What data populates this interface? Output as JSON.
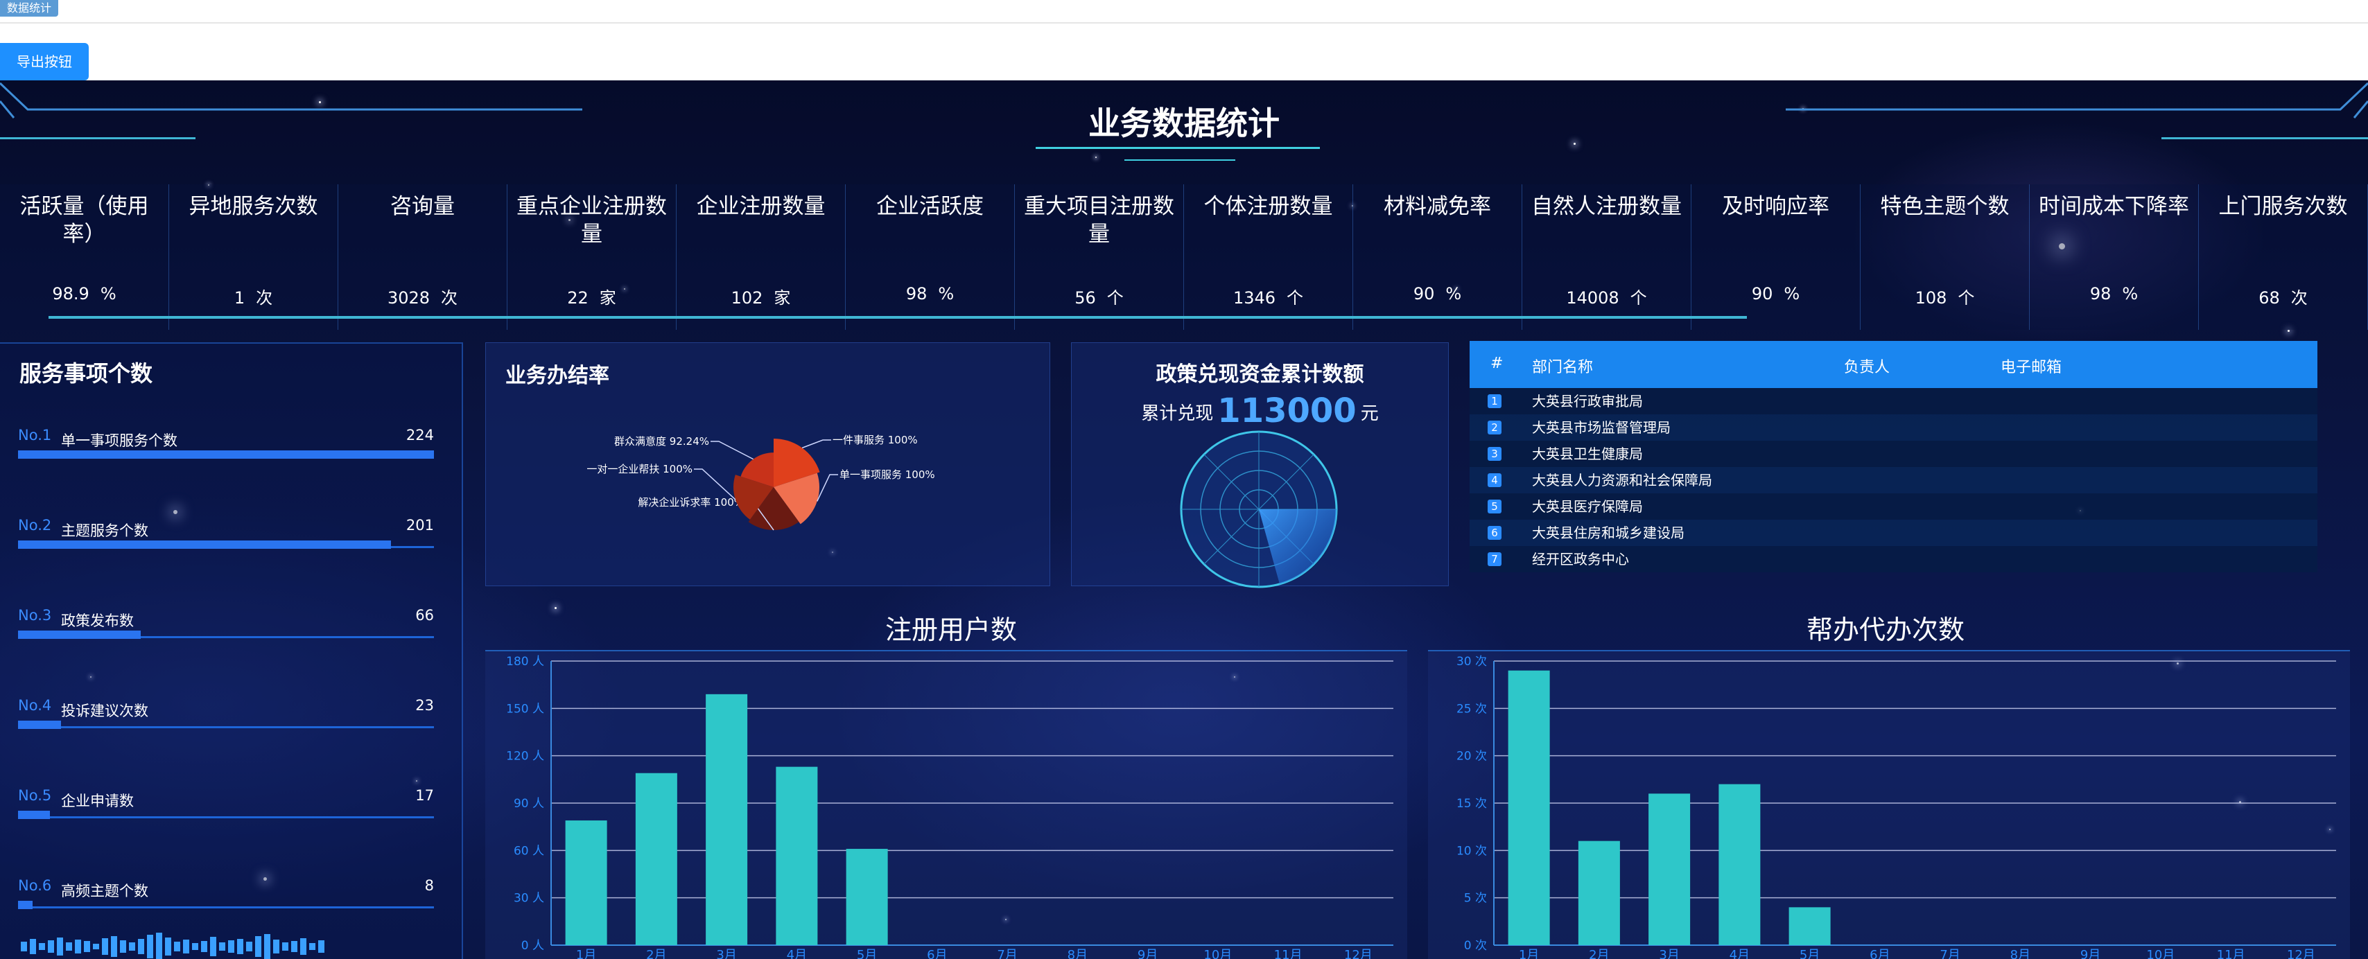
{
  "top": {
    "tab_label": "数据统计",
    "export_label": "导出按钮"
  },
  "title": "业务数据统计",
  "stats": [
    {
      "label": "活跃量（使用率）",
      "value": "98.9",
      "unit": "%"
    },
    {
      "label": "异地服务次数",
      "value": "1",
      "unit": "次"
    },
    {
      "label": "咨询量",
      "value": "3028",
      "unit": "次"
    },
    {
      "label": "重点企业注册数量",
      "value": "22",
      "unit": "家"
    },
    {
      "label": "企业注册数量",
      "value": "102",
      "unit": "家"
    },
    {
      "label": "企业活跃度",
      "value": "98",
      "unit": "%"
    },
    {
      "label": "重大项目注册数量",
      "value": "56",
      "unit": "个"
    },
    {
      "label": "个体注册数量",
      "value": "1346",
      "unit": "个"
    },
    {
      "label": "材料减免率",
      "value": "90",
      "unit": "%"
    },
    {
      "label": "自然人注册数量",
      "value": "14008",
      "unit": "个"
    },
    {
      "label": "及时响应率",
      "value": "90",
      "unit": "%"
    },
    {
      "label": "特色主题个数",
      "value": "108",
      "unit": "个"
    },
    {
      "label": "时间成本下降率",
      "value": "98",
      "unit": "%"
    },
    {
      "label": "上门服务次数",
      "value": "68",
      "unit": "次"
    }
  ],
  "services": {
    "title": "服务事项个数",
    "max": 224,
    "items": [
      {
        "no": "No.1",
        "name": "单一事项服务个数",
        "count": 224
      },
      {
        "no": "No.2",
        "name": "主题服务个数",
        "count": 201
      },
      {
        "no": "No.3",
        "name": "政策发布数",
        "count": 66
      },
      {
        "no": "No.4",
        "name": "投诉建议次数",
        "count": 23
      },
      {
        "no": "No.5",
        "name": "企业申请数",
        "count": 17
      },
      {
        "no": "No.6",
        "name": "高频主题个数",
        "count": 8
      }
    ]
  },
  "rate": {
    "title": "业务办结率",
    "slices": [
      {
        "label": "一件事服务 100%",
        "value": 100,
        "color": "#e0401c"
      },
      {
        "label": "单一事项服务 100%",
        "value": 100,
        "color": "#f07050"
      },
      {
        "label": "解决企业诉求率 100%",
        "value": 100,
        "color": "#6a1a12"
      },
      {
        "label": "一对一企业帮扶 100%",
        "value": 100,
        "color": "#a02a14"
      },
      {
        "label": "群众满意度 92.24%",
        "value": 92.24,
        "color": "#c8321a"
      }
    ]
  },
  "fund": {
    "title": "政策兑现资金累计数额",
    "prefix": "累计兑现",
    "amount": "113000",
    "unit": "元"
  },
  "departments": {
    "headers": {
      "idx": "#",
      "name": "部门名称",
      "owner": "负责人",
      "email": "电子邮箱"
    },
    "rows": [
      {
        "idx": "1",
        "name": "大英县行政审批局"
      },
      {
        "idx": "2",
        "name": "大英县市场监督管理局"
      },
      {
        "idx": "3",
        "name": "大英县卫生健康局"
      },
      {
        "idx": "4",
        "name": "大英县人力资源和社会保障局"
      },
      {
        "idx": "5",
        "name": "大英县医疗保障局"
      },
      {
        "idx": "6",
        "name": "大英县住房和城乡建设局"
      },
      {
        "idx": "7",
        "name": "经开区政务中心"
      }
    ]
  },
  "chart_data": [
    {
      "type": "bar",
      "title": "注册用户数",
      "categories": [
        "1月",
        "2月",
        "3月",
        "4月",
        "5月",
        "6月",
        "7月",
        "8月",
        "9月",
        "10月",
        "11月",
        "12月"
      ],
      "values": [
        79,
        109,
        159,
        113,
        61,
        0,
        0,
        0,
        0,
        0,
        0,
        0
      ],
      "yticks": [
        "0 人",
        "30 人",
        "60 人",
        "90 人",
        "120 人",
        "150 人",
        "180 人"
      ],
      "ylim": [
        0,
        180
      ],
      "color": "#2ec7c9"
    },
    {
      "type": "bar",
      "title": "帮办代办次数",
      "categories": [
        "1月",
        "2月",
        "3月",
        "4月",
        "5月",
        "6月",
        "7月",
        "8月",
        "9月",
        "10月",
        "11月",
        "12月"
      ],
      "values": [
        29,
        11,
        16,
        17,
        4,
        0,
        0,
        0,
        0,
        0,
        0,
        0
      ],
      "yticks": [
        "0 次",
        "5 次",
        "10 次",
        "15 次",
        "20 次",
        "25 次",
        "30 次"
      ],
      "ylim": [
        0,
        30
      ],
      "color": "#2ec7c9"
    }
  ]
}
